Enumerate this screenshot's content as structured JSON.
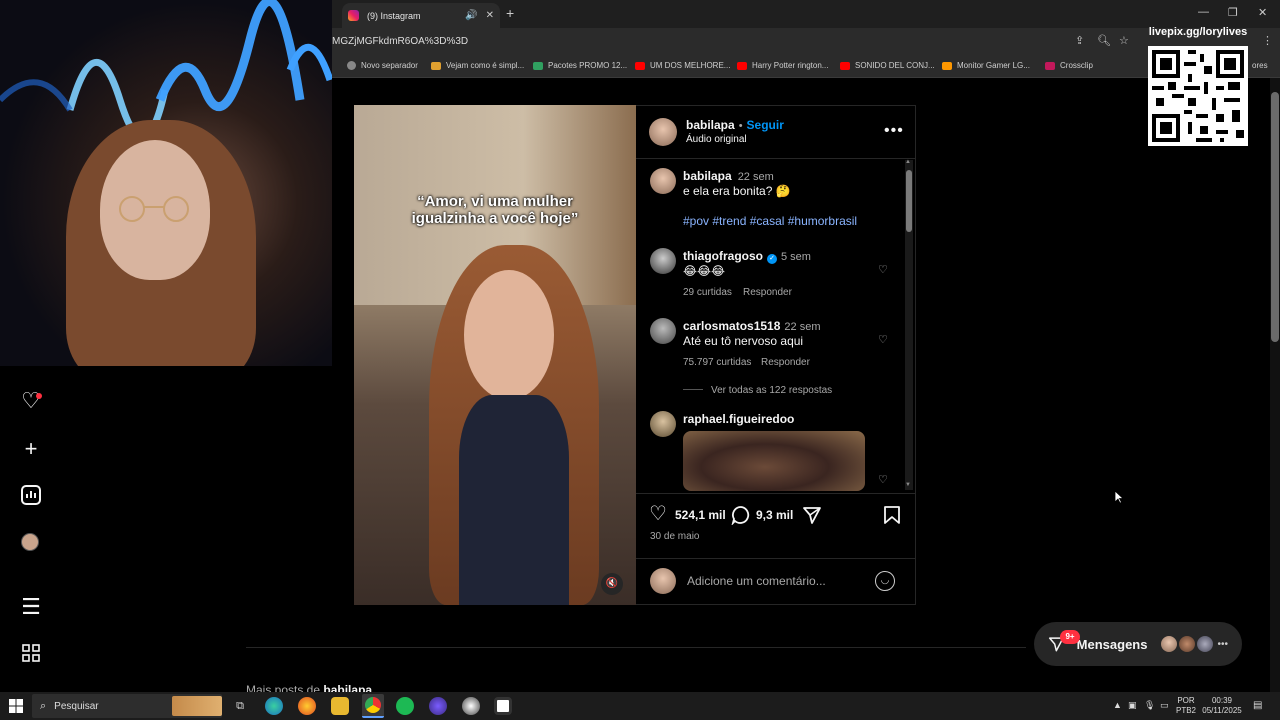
{
  "browser": {
    "tab_title": "(9) Instagram",
    "url": "MGZjMGFkdmR6OA%3D%3D",
    "bookmarks": [
      {
        "label": "Novo separador",
        "color": "#888888"
      },
      {
        "label": "Vejam como é simpl...",
        "color": "#e0a030"
      },
      {
        "label": "Pacotes PROMO 12...",
        "color": "#30a060"
      },
      {
        "label": "UM DOS MELHORE...",
        "color": "#ff0000"
      },
      {
        "label": "Harry Potter rington...",
        "color": "#ff0000"
      },
      {
        "label": "SONIDO DEL CONJ...",
        "color": "#ff0000"
      },
      {
        "label": "Monitor Gamer LG...",
        "color": "#ff9800"
      },
      {
        "label": "Crossclip",
        "color": "#c2185b"
      }
    ],
    "bookmarks_more": "ores"
  },
  "stream": {
    "qr_label": "livepix.gg/lorylives"
  },
  "post": {
    "caption_overlay": "“Amor, vi uma mulher\nigualzinha a você hoje”",
    "author": "babilapa",
    "follow": "Seguir",
    "separator": "•",
    "audio": "Áudio original",
    "description": {
      "username": "babilapa",
      "time": "22 sem",
      "text": "e ela era bonita? 🤔",
      "tags": "#pov #trend #casal #humorbrasil"
    },
    "comments": [
      {
        "username": "thiagofragoso",
        "verified": true,
        "time": "5 sem",
        "text": "😂😂😂",
        "likes": "29 curtidas",
        "reply": "Responder"
      },
      {
        "username": "carlosmatos1518",
        "verified": false,
        "time": "22 sem",
        "text": "Até eu tô nervoso aqui",
        "likes": "75.797 curtidas",
        "reply": "Responder",
        "view_replies": "Ver todas as 122 respostas"
      },
      {
        "username": "raphael.figueiredoo",
        "verified": false,
        "time": "",
        "text": "",
        "likes": "",
        "reply": ""
      }
    ],
    "likes": "524,1 mil",
    "comments_count": "9,3 mil",
    "date": "30 de maio",
    "comment_placeholder": "Adicione um comentário..."
  },
  "more_posts": {
    "prefix": "Mais posts de",
    "username": "babilapa"
  },
  "messages": {
    "label": "Mensagens",
    "badge": "9+"
  },
  "taskbar": {
    "search_placeholder": "Pesquisar",
    "lang": "POR",
    "layout": "PTB2",
    "time": "00:39",
    "date": "05/11/2025"
  },
  "colors": {
    "accent": "#0095f6",
    "link": "#8ab4ff",
    "badge": "#ff3040"
  }
}
